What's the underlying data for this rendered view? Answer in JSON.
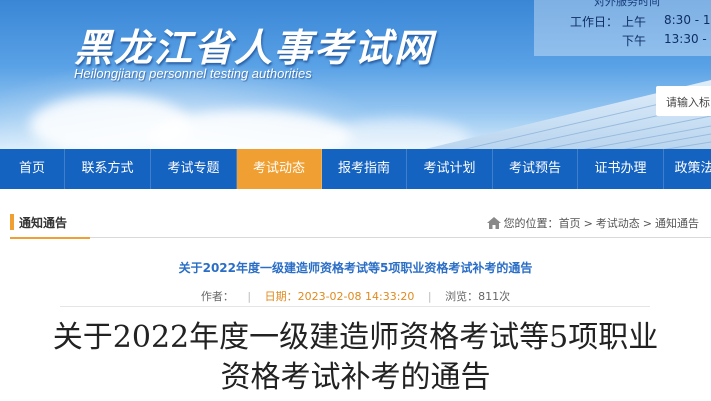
{
  "banner": {
    "title": "黑龙江省人事考试网",
    "subtitle": "Heilongjiang personnel testing authorities",
    "hours_cut": "对外服务时间",
    "hours_label": "工作日：",
    "hours_am_label": "上午",
    "hours_am": "8:30 - 1",
    "hours_pm_label": "下午",
    "hours_pm": "13:30 - 1",
    "search_placeholder": "请输入标"
  },
  "nav": {
    "items": [
      {
        "label": "首页"
      },
      {
        "label": "联系方式"
      },
      {
        "label": "考试专题"
      },
      {
        "label": "考试动态"
      },
      {
        "label": "报考指南"
      },
      {
        "label": "考试计划"
      },
      {
        "label": "考试预告"
      },
      {
        "label": "证书办理"
      },
      {
        "label": "政策法"
      }
    ],
    "active_index": 3,
    "colors": {
      "bar": "#1563c0",
      "active": "#f0a033"
    }
  },
  "section": {
    "title": "通知通告",
    "crumb_prefix": "您的位置：",
    "crumb_home": "首页",
    "crumb_sep": ">",
    "crumb_mid": "考试动态",
    "crumb_last": "通知通告"
  },
  "article": {
    "link_title": "关于2022年度一级建造师资格考试等5项职业资格考试补考的通告",
    "author_label": "作者：",
    "author": "",
    "date_label": "日期：",
    "date": "2023-02-08 14:33:20",
    "views_label": "浏览：",
    "views": "811次",
    "title_line1": "关于2022年度一级建造师资格考试等5项职业",
    "title_line2": "资格考试补考的通告"
  }
}
